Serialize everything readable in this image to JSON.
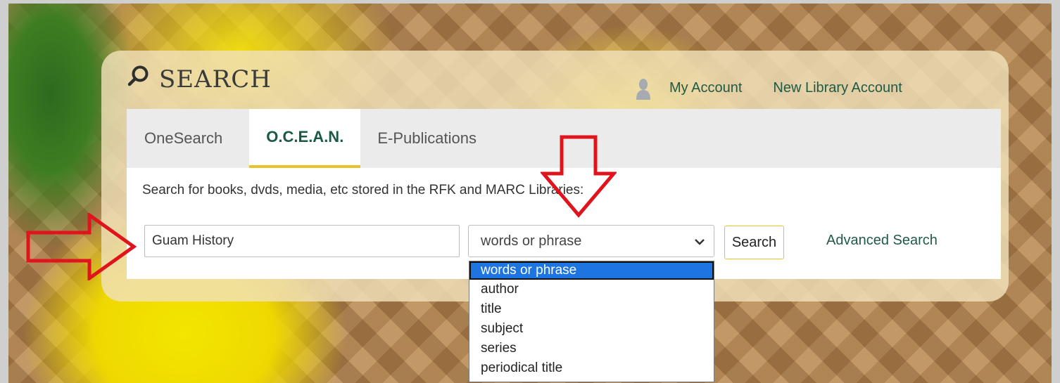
{
  "header": {
    "title": "SEARCH",
    "account_link": "My Account",
    "new_account_link": "New Library Account"
  },
  "tabs": [
    {
      "label": "OneSearch",
      "active": false
    },
    {
      "label": "O.C.E.A.N.",
      "active": true
    },
    {
      "label": "E-Publications",
      "active": false
    }
  ],
  "description": "Search for books, dvds, media, etc stored in the RFK and MARC Libraries:",
  "search": {
    "value": "Guam History",
    "button_label": "Search",
    "advanced_label": "Advanced Search"
  },
  "select": {
    "selected": "words or phrase",
    "options": [
      "words or phrase",
      "author",
      "title",
      "subject",
      "series",
      "periodical title"
    ]
  },
  "colors": {
    "accent_green": "#1f5a45",
    "tab_underline": "#e8c22a",
    "annotation_red": "#e0141c",
    "selected_option_bg": "#1e74e0"
  },
  "icons": [
    "search-icon",
    "user-icon",
    "chevron-down-icon",
    "red-arrow-right",
    "red-arrow-down"
  ]
}
